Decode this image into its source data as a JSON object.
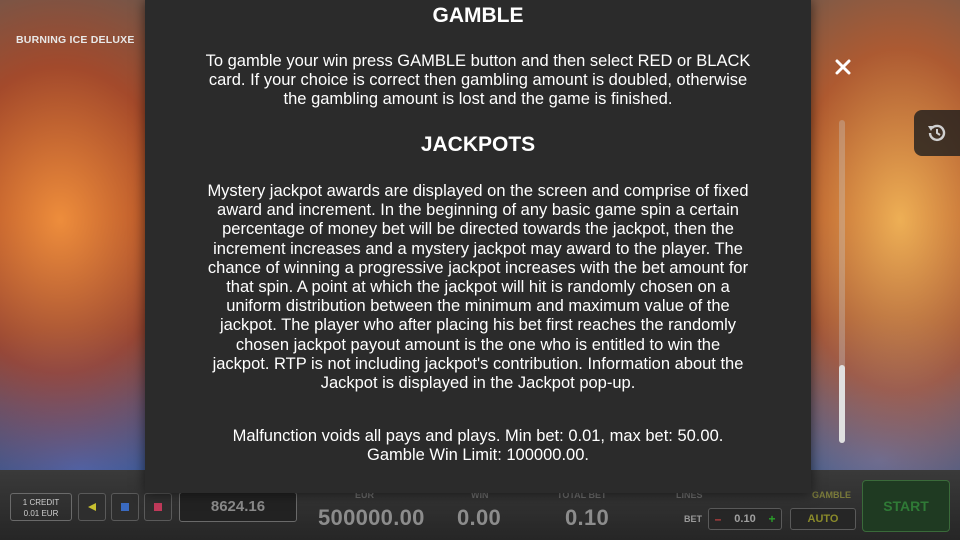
{
  "game": {
    "title": "BURNING ICE DELUXE",
    "close_glyph": "✖"
  },
  "modal": {
    "gamble_title": "GAMBLE",
    "gamble_lines": [
      "To gamble your win press GAMBLE button and then select RED or BLACK",
      "card. If your choice is correct then gambling amount is doubled, otherwise",
      "the gambling amount is lost and the game is finished."
    ],
    "jackpots_title": "JACKPOTS",
    "jackpots_lines": [
      "Mystery jackpot awards are displayed on the screen and comprise of fixed",
      "award and increment. In the beginning of any basic game spin a certain",
      "percentage of money bet will be directed towards the jackpot, then the",
      "increment increases and a mystery jackpot may award to the player. The",
      "chance of winning a progressive jackpot increases with the bet amount for",
      "that spin. A point at which the jackpot will hit is randomly chosen on a",
      "uniform distribution between the minimum and maximum value of the",
      "jackpot. The player who after placing his bet first reaches the randomly",
      "chosen jackpot payout amount is the one who is entitled to win the",
      "jackpot. RTP is not including jackpot's contribution. Information about the",
      "Jackpot is displayed in the Jackpot pop-up."
    ],
    "limits_lines": [
      "Malfunction voids all pays and plays. Min bet: 0.01, max bet: 50.00.",
      "Gamble Win Limit: 100000.00."
    ]
  },
  "bottom_bar": {
    "credit_label": "1 CREDIT",
    "credit_value": "0.01 EUR",
    "balance": "8624.16",
    "currency_label": "EUR",
    "jackpot_value": "500000.00",
    "win_label": "WIN",
    "win_value": "0.00",
    "total_bet_label": "TOTAL BET",
    "total_bet_value": "0.10",
    "lines_label": "LINES",
    "bet_label": "BET",
    "bet_value": "0.10",
    "bet_minus": "–",
    "bet_plus": "+",
    "gamble_label": "GAMBLE",
    "auto_label": "AUTO",
    "start_label": "START"
  },
  "colors": {
    "modal_bg": "#2b2b2b",
    "modal_text": "#ffffff",
    "start_green": "#2f7a36",
    "auto_text": "#8a8a2a"
  },
  "icons": {
    "close": "close-icon",
    "history": "history-icon",
    "left_arrow": "arrow-left-icon",
    "sound": "sound-icon"
  },
  "scroll": {
    "position_fraction": 0.76
  }
}
